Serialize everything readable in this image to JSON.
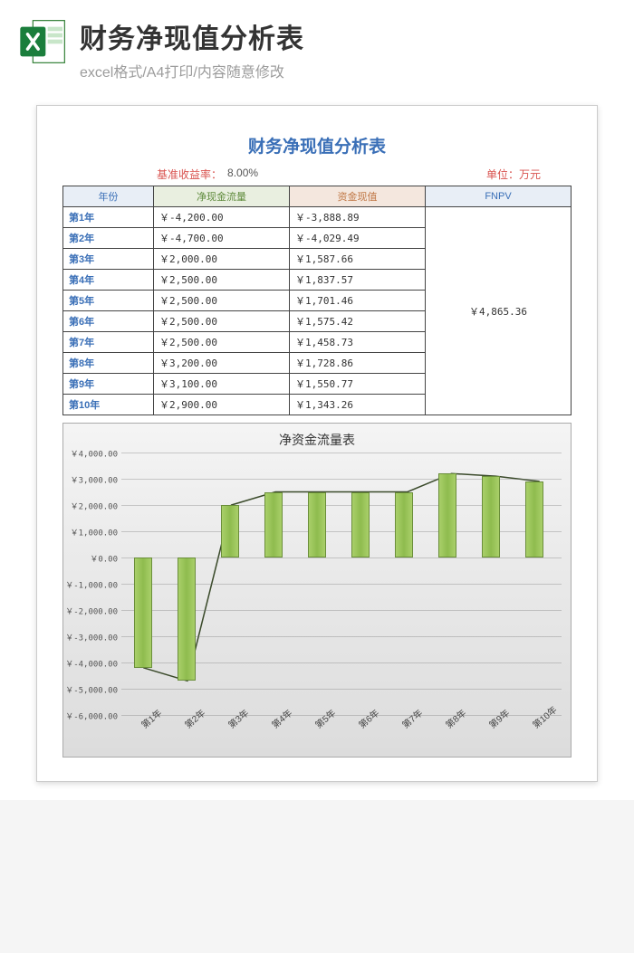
{
  "header": {
    "title": "财务净现值分析表",
    "subtitle": "excel格式/A4打印/内容随意修改"
  },
  "doc": {
    "title": "财务净现值分析表",
    "rate_label": "基准收益率：",
    "rate_value": "8.00%",
    "unit_label": "单位：万元"
  },
  "table": {
    "headers": {
      "year": "年份",
      "cashflow": "净现金流量",
      "pv": "资金现值",
      "fnpv": "FNPV"
    },
    "rows": [
      {
        "year": "第1年",
        "cashflow": "￥-4,200.00",
        "pv": "￥-3,888.89"
      },
      {
        "year": "第2年",
        "cashflow": "￥-4,700.00",
        "pv": "￥-4,029.49"
      },
      {
        "year": "第3年",
        "cashflow": "￥2,000.00",
        "pv": "￥1,587.66"
      },
      {
        "year": "第4年",
        "cashflow": "￥2,500.00",
        "pv": "￥1,837.57"
      },
      {
        "year": "第5年",
        "cashflow": "￥2,500.00",
        "pv": "￥1,701.46"
      },
      {
        "year": "第6年",
        "cashflow": "￥2,500.00",
        "pv": "￥1,575.42"
      },
      {
        "year": "第7年",
        "cashflow": "￥2,500.00",
        "pv": "￥1,458.73"
      },
      {
        "year": "第8年",
        "cashflow": "￥3,200.00",
        "pv": "￥1,728.86"
      },
      {
        "year": "第9年",
        "cashflow": "￥3,100.00",
        "pv": "￥1,550.77"
      },
      {
        "year": "第10年",
        "cashflow": "￥2,900.00",
        "pv": "￥1,343.26"
      }
    ],
    "fnpv_value": "￥4,865.36"
  },
  "chart_data": {
    "type": "bar",
    "title": "净资金流量表",
    "categories": [
      "第1年",
      "第2年",
      "第3年",
      "第4年",
      "第5年",
      "第6年",
      "第7年",
      "第8年",
      "第9年",
      "第10年"
    ],
    "values": [
      -4200,
      -4700,
      2000,
      2500,
      2500,
      2500,
      2500,
      3200,
      3100,
      2900
    ],
    "ylim": [
      -6000,
      4000
    ],
    "yticks": [
      4000,
      3000,
      2000,
      1000,
      0,
      -1000,
      -2000,
      -3000,
      -4000,
      -5000,
      -6000
    ],
    "ytick_labels": [
      "￥4,000.00",
      "￥3,000.00",
      "￥2,000.00",
      "￥1,000.00",
      "￥0.00",
      "￥-1,000.00",
      "￥-2,000.00",
      "￥-3,000.00",
      "￥-4,000.00",
      "￥-5,000.00",
      "￥-6,000.00"
    ],
    "xlabel": "",
    "ylabel": ""
  }
}
